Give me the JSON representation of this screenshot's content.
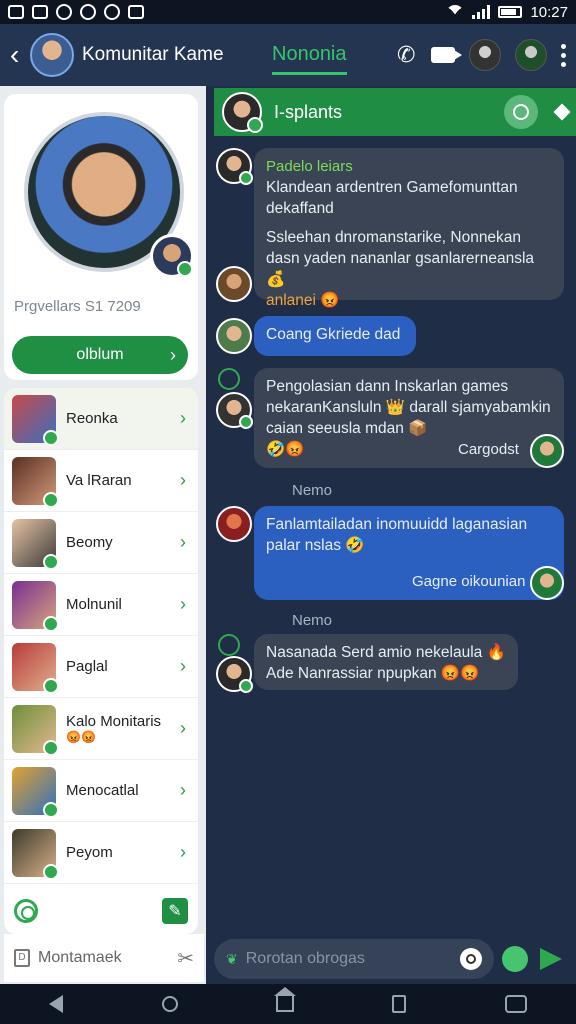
{
  "status_bar": {
    "time": "10:27"
  },
  "header": {
    "title": "Komunitar Kame",
    "active_tab": "Nononia"
  },
  "profile": {
    "status": "Prgvellars S1 7209",
    "button_label": "olblum"
  },
  "contacts": [
    {
      "name": "Reonka",
      "emoji": ""
    },
    {
      "name": "Va lRaran",
      "emoji": ""
    },
    {
      "name": "Beomy",
      "emoji": ""
    },
    {
      "name": "Molnunil",
      "emoji": ""
    },
    {
      "name": "Paglal",
      "emoji": ""
    },
    {
      "name": "Kalo Monitaris",
      "emoji": "😡😡"
    },
    {
      "name": "Menocatlal",
      "emoji": ""
    },
    {
      "name": "Peyom",
      "emoji": ""
    }
  ],
  "left_bottom": {
    "label": "Montamaek"
  },
  "chat": {
    "header_name": "I-splants",
    "messages": [
      {
        "sender": "Padelo leiars",
        "text1": "Klandean ardentren Gamefomunttan dekaffand",
        "text2": "Ssleehan dnromanstarike, Nonnekan dasn yaden nananlar gsanlarerneansla 💰",
        "highlight": "anlanei 😡"
      },
      {
        "text": "Coang Gkriede dad"
      },
      {
        "text": "Pengolasian dann Inskarlan games nekaranKansluln 👑 darall sjamyabamkin caian seeusla mdan 📦",
        "emoji": "🤣😡",
        "signature": "Cargodst"
      },
      {
        "text": "Fanlamtailadan inomuuidd laganasian palar nslas 🤣",
        "signature": "Gagne oikounian"
      },
      {
        "text": "Nasanada Serd amio nekelaula 🔥 Ade Nanrassiar npupkan 😡😡"
      }
    ],
    "day_labels": [
      "Nemo",
      "Nemo"
    ]
  },
  "input": {
    "placeholder": "Rorotan obrogas"
  }
}
